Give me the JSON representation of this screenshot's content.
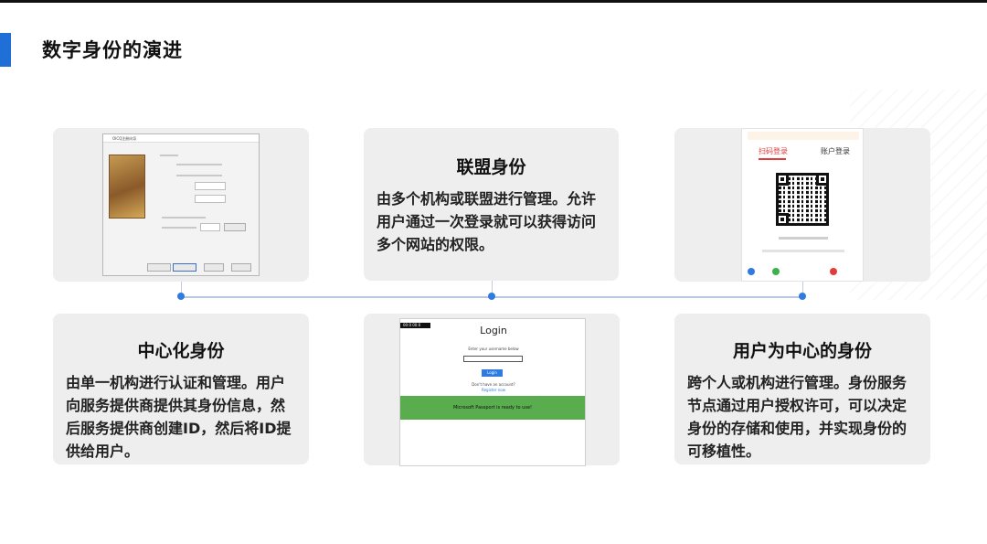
{
  "slide": {
    "title": "数字身份的演进"
  },
  "cards": {
    "federated": {
      "heading": "联盟身份",
      "body": "由多个机构或联盟进行管理。允许用户通过一次登录就可以获得访问多个网站的权限。"
    },
    "centralized": {
      "heading": "中心化身份",
      "body": "由单一机构进行认证和管理。用户向服务提供商提供其身份信息，然后服务提供商创建ID，然后将ID提供给用户。"
    },
    "user_centric": {
      "heading": "用户为中心的身份",
      "body": "跨个人或机构进行管理。身份服务节点通过用户授权许可，可以决定身份的存储和使用，并实现身份的可移植性。"
    }
  },
  "screens": {
    "legacy_dialog": {
      "title": "OICQ注册向导",
      "icon": "legacy-app-icon"
    },
    "qr_login": {
      "tab_active": "扫码登录",
      "tab_other": "账户登录"
    },
    "passport_login": {
      "badge": "00:0 00:0",
      "heading": "Login",
      "prompt": "Enter your username below",
      "button": "Login",
      "no_account": "Don't have an account?",
      "register": "Register now",
      "banner": "Microsoft Passport is ready to use!"
    }
  },
  "colors": {
    "accent": "#1f6fd6",
    "card_bg": "#eeeeef",
    "timeline": "#b9c7e3",
    "dot": "#2f7be0"
  }
}
